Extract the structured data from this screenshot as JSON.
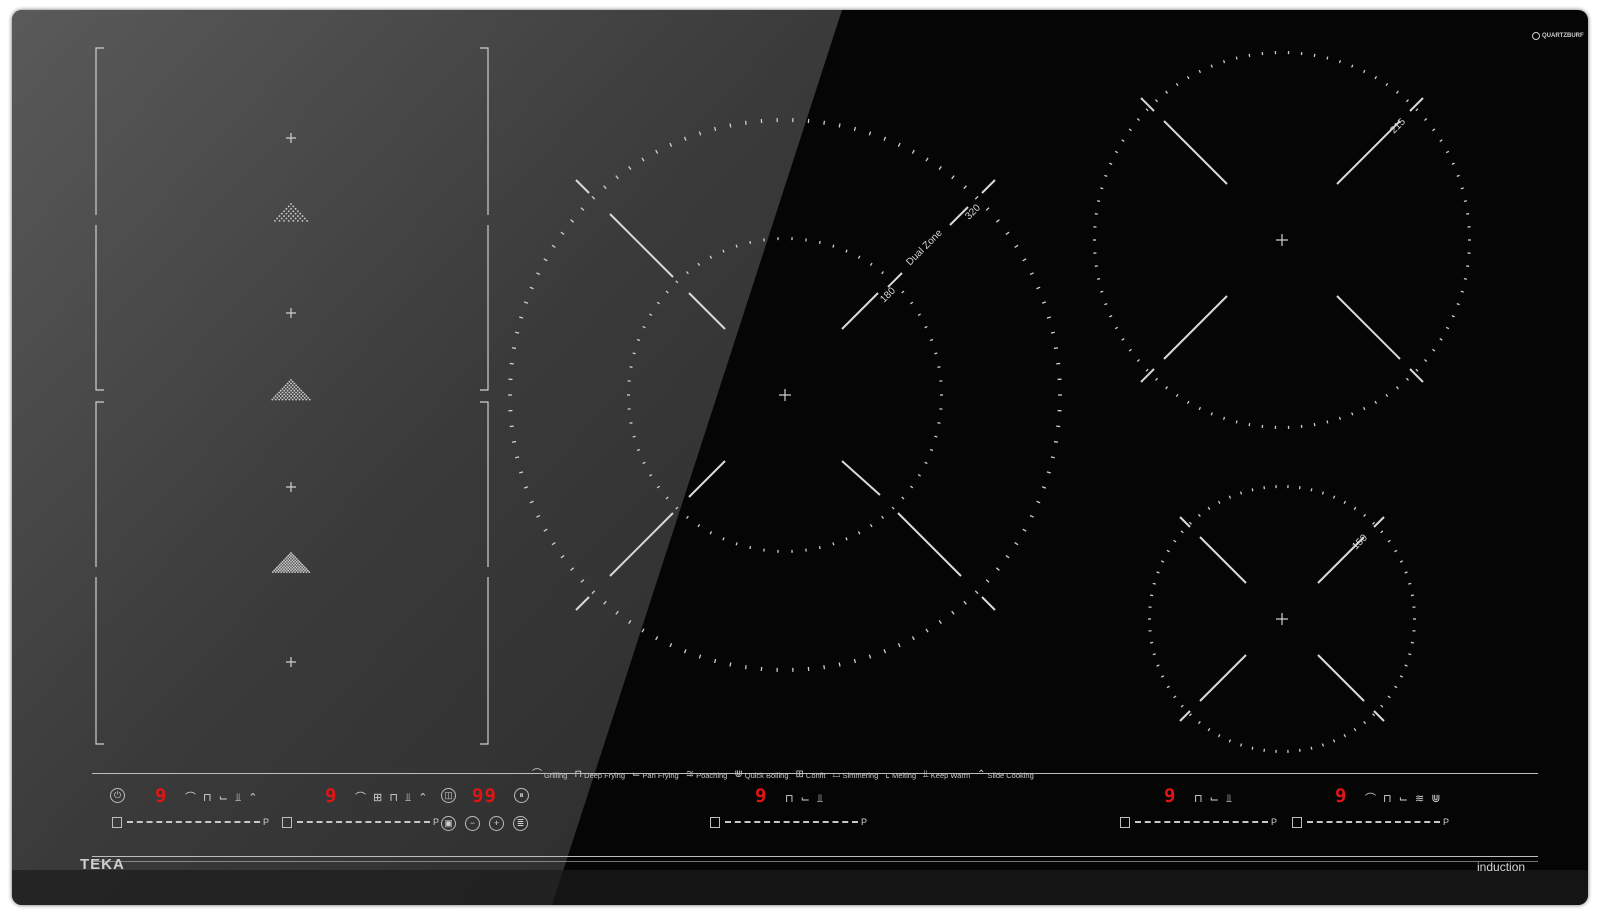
{
  "brand": {
    "logo_text": "TEKA",
    "technology_label": "induction",
    "glass_brand": "QUARTZBURF"
  },
  "zones": {
    "flex_zone_markers": [
      "+",
      "+",
      "+",
      "+"
    ],
    "dual_zone": {
      "label": "Dual Zone",
      "inner_size": "180",
      "outer_size": "320"
    },
    "rear_right_size": "215",
    "front_right_size": "150"
  },
  "functions": [
    {
      "icon": "grill-icon",
      "glyph": "⌒",
      "label": "Grilling"
    },
    {
      "icon": "fryer-icon",
      "glyph": "⊓",
      "label": "Deep Frying"
    },
    {
      "icon": "pan-icon",
      "glyph": "⌙",
      "label": "Pan Frying"
    },
    {
      "icon": "poach-icon",
      "glyph": "≋",
      "label": "Poaching"
    },
    {
      "icon": "boil-icon",
      "glyph": "⋓",
      "label": "Quick Boiling"
    },
    {
      "icon": "confit-icon",
      "glyph": "⊞",
      "label": "Confit"
    },
    {
      "icon": "simmer-icon",
      "glyph": "⌓",
      "label": "Simmering"
    },
    {
      "icon": "melt-icon",
      "glyph": "⌞",
      "label": "Melting"
    },
    {
      "icon": "warm-icon",
      "glyph": "⫫",
      "label": "Keep Warm"
    },
    {
      "icon": "slide-icon",
      "glyph": "⌃",
      "label": "Slide Cooking"
    }
  ],
  "controls": {
    "power_symbol": "⏻",
    "pause_symbol": "⏸",
    "minus_symbol": "−",
    "plus_symbol": "+",
    "slider_end_label": "P",
    "displays": [
      {
        "id": "left-flex-1",
        "value": "9",
        "icons": "⌒ ⊓ ⌙ ⫫ ⌃"
      },
      {
        "id": "left-flex-2",
        "value": "9",
        "icons": "⌒ ⊞ ⊓ ⫫ ⌃"
      },
      {
        "id": "timer",
        "value": "99"
      },
      {
        "id": "center-dual",
        "value": "9",
        "icons": "⊓ ⌙ ⫫"
      },
      {
        "id": "rear-right",
        "value": "9",
        "icons": "⊓ ⌙ ⫫"
      },
      {
        "id": "front-right",
        "value": "9",
        "icons": "⌒ ⊓ ⌙ ≋ ⋓"
      }
    ]
  },
  "colors": {
    "glass": "#050505",
    "display_red": "#e01515",
    "print": "#c8c8c8"
  }
}
